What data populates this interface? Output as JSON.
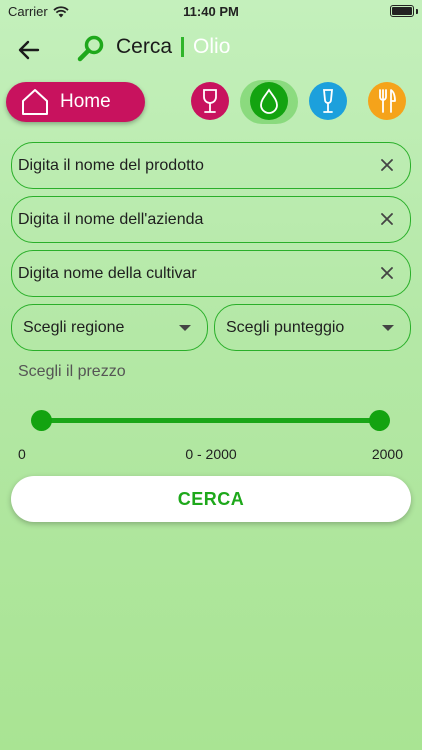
{
  "status_bar": {
    "carrier": "Carrier",
    "time": "11:40 PM"
  },
  "header": {
    "title": "Cerca",
    "subtitle": "Olio"
  },
  "nav": {
    "home_label": "Home",
    "categories": [
      {
        "name": "vino",
        "icon": "wine-glass-icon",
        "color": "#c8125e",
        "active": false
      },
      {
        "name": "olio",
        "icon": "oil-drop-icon",
        "color": "#13a310",
        "active": true
      },
      {
        "name": "spumante",
        "icon": "champagne-glass-icon",
        "color": "#1ca0dc",
        "active": false
      },
      {
        "name": "ristoranti",
        "icon": "fork-knife-icon",
        "color": "#f5a31a",
        "active": false
      }
    ]
  },
  "form": {
    "product_placeholder": "Digita il nome del prodotto",
    "company_placeholder": "Digita il nome dell'azienda",
    "cultivar_placeholder": "Digita nome della cultivar",
    "region_select": "Scegli regione",
    "score_select": "Scegli punteggio",
    "price_label": "Scegli il prezzo",
    "price_min": "0",
    "price_range": "0 - 2000",
    "price_max": "2000",
    "search_button": "CERCA"
  },
  "colors": {
    "accent": "#2aaf2a",
    "home": "#c8125e",
    "background": "#b4e8a6"
  }
}
